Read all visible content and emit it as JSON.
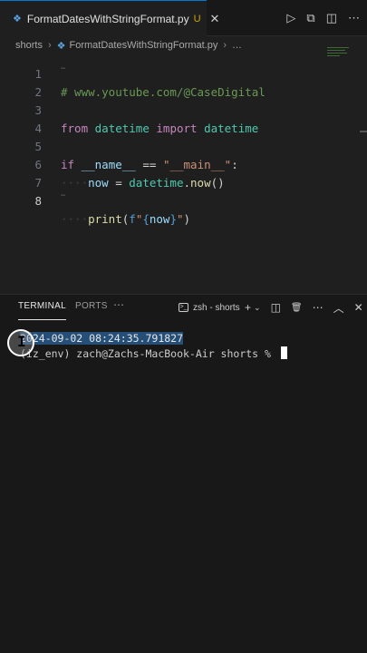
{
  "tab": {
    "file_icon": "❖",
    "file_name": "FormatDatesWithStringFormat.py",
    "modified": "U",
    "close": "✕"
  },
  "toolbar": {
    "run": "▷",
    "compare": "⧉",
    "split": "◫",
    "more": "⋯"
  },
  "breadcrumb": {
    "folder": "shorts",
    "sep": "›",
    "file_icon": "❖",
    "file": "FormatDatesWithStringFormat.py",
    "more": "…"
  },
  "editor": {
    "line_numbers": [
      "1",
      "2",
      "3",
      "4",
      "5",
      "6",
      "7",
      "8"
    ],
    "line1": {
      "comment": "# www.youtube.com/@CaseDigital"
    },
    "line3": {
      "kw1": "from",
      "mod": "datetime",
      "kw2": "import",
      "cls": "datetime"
    },
    "line5": {
      "kw": "if",
      "var": "__name__",
      "op": "==",
      "str": "\"__main__\"",
      "colon": ":"
    },
    "line6": {
      "indent": "····",
      "var": "now",
      "op": " = ",
      "cls": "datetime",
      "dot": ".",
      "fn": "now",
      "parens": "()"
    },
    "line8": {
      "indent": "····",
      "fn": "print",
      "open": "(",
      "f": "f",
      "q1": "\"",
      "b1": "{",
      "var": "now",
      "b2": "}",
      "q2": "\"",
      "close": ")"
    },
    "suggestion_dots": "⋯"
  },
  "panel": {
    "tabs": [
      "TERMINAL",
      "PORTS"
    ],
    "more": "⋯",
    "shell_icon": ">_",
    "shell_label": "zsh - shorts",
    "actions": [
      "+",
      "⌄",
      "◫",
      "🗑",
      "⋯",
      "︿",
      "✕"
    ]
  },
  "terminal": {
    "output_line": "2024-09-02 08:24:35.791827",
    "prompt": "(iz_env) zach@Zachs-MacBook-Air shorts % "
  },
  "colors": {
    "accent": "#0078d4",
    "selection": "#264f78",
    "comment": "#6a9955",
    "keyword": "#c586c0",
    "string": "#ce9178"
  }
}
